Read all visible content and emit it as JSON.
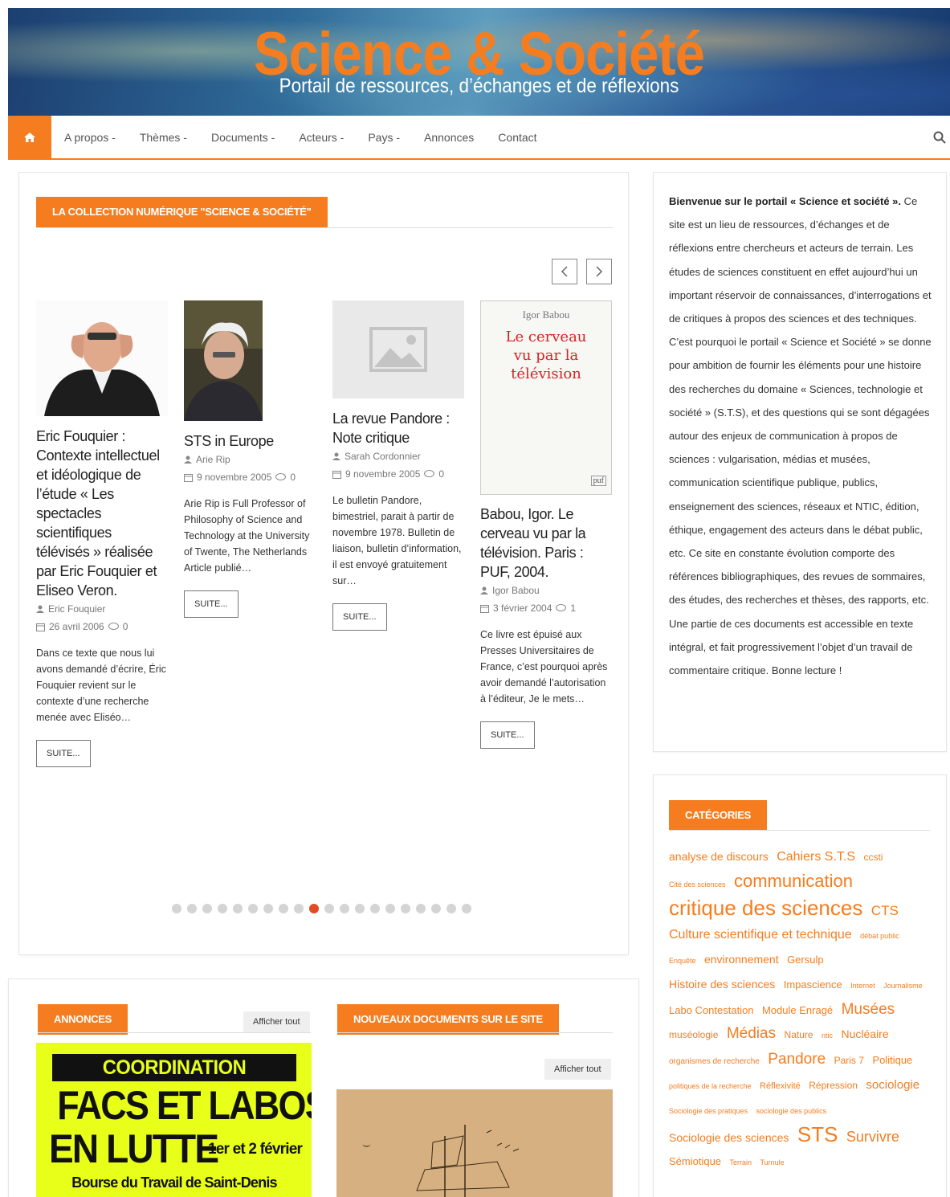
{
  "header": {
    "title": "Science & Société",
    "subtitle": "Portail de ressources, d’échanges et de réflexions"
  },
  "nav": {
    "home_icon": "home-icon",
    "items": [
      "A propos -",
      "Thèmes -",
      "Documents -",
      "Acteurs -",
      "Pays -",
      "Annonces",
      "Contact"
    ],
    "search_icon": "search-icon"
  },
  "collection": {
    "heading": "LA COLLECTION NUMÉRIQUE \"SCIENCE & SOCIÉTÉ\"",
    "prev_icon": "chevron-left-icon",
    "next_icon": "chevron-right-icon",
    "cards": [
      {
        "title": "Eric Fouquier : Contexte intellectuel et idéologique de l’étude « Les spectacles scientifiques télévisés » réalisée par Eric Fouquier et Eliseo Veron.",
        "author": "Eric Fouquier",
        "date": "26 avril 2006",
        "comments": "0",
        "excerpt": "Dans ce texte que nous lui avons demandé d’écrire, Éric Fouquier revient sur le contexte d’une recherche menée avec Eliséo…",
        "button": "SUITE..."
      },
      {
        "title": "STS in Europe",
        "author": "Arie Rip",
        "date": "9 novembre 2005",
        "comments": "0",
        "excerpt": "Arie Rip is Full Professor of Philosophy of Science and Technology at the University of Twente, The Netherlands Article publié…",
        "button": "SUITE..."
      },
      {
        "title": "La revue Pandore : Note critique",
        "author": "Sarah Cordonnier",
        "date": "9 novembre 2005",
        "comments": "0",
        "excerpt": "Le bulletin Pandore, bimestriel, parait à partir de novembre 1978. Bulletin de liaison, bulletin d’information, il est envoyé gratuitement sur…",
        "button": "SUITE..."
      },
      {
        "title": "Babou, Igor. Le cerveau vu par la télévision. Paris : PUF, 2004.",
        "author": "Igor Babou",
        "date": "3 février 2004",
        "comments": "1",
        "excerpt": "Ce livre est épuisé aux Presses Universitaires de France, c’est pourquoi après avoir demandé l’autorisation à l’éditeur, Je le mets…",
        "button": "SUITE..."
      }
    ],
    "book_cover": {
      "author": "Igor Babou",
      "title": "Le cerveau vu par la télévision",
      "publisher": "puf"
    },
    "dots_total": 20,
    "dots_active_index": 9
  },
  "intro": {
    "bold": "Bienvenue sur le portail « Science et société ».",
    "text": " Ce site est un lieu de ressources, d’échanges et de réflexions entre chercheurs et acteurs de terrain. Les études de sciences constituent en effet aujourd’hui un important réservoir de connaissances, d’interrogations et de critiques à propos des sciences et des techniques. C’est pourquoi le portail « Science et Société » se donne pour ambition de fournir les éléments pour une histoire des recherches du domaine « Sciences, technologie et société » (S.T.S), et des questions qui se sont dégagées autour des enjeux de communication à propos de sciences : vulgarisation, médias et musées, communication scientifique publique, publics, enseignement des sciences, réseaux et NTIC, édition, éthique, engagement des acteurs dans le débat public, etc. Ce site en constante évolution comporte des références bibliographiques, des revues de sommaires, des études, des recherches et thèses, des rapports, etc. Une partie de ces documents est accessible en texte intégral, et fait progressivement l’objet d’un travail de commentaire critique. Bonne lecture !"
  },
  "categories": {
    "heading": "CATÉGORIES",
    "tags": [
      {
        "label": "analyse de discours",
        "size": 14
      },
      {
        "label": "Cahiers S.T.S",
        "size": 16
      },
      {
        "label": "ccsti",
        "size": 12
      },
      {
        "label": "Cité des sciences",
        "size": 9
      },
      {
        "label": "communication",
        "size": 22
      },
      {
        "label": "critique des sciences",
        "size": 26
      },
      {
        "label": "CTS",
        "size": 17
      },
      {
        "label": "Culture scientifique et technique",
        "size": 16
      },
      {
        "label": "débat public",
        "size": 9
      },
      {
        "label": "Enquête",
        "size": 9
      },
      {
        "label": "environnement",
        "size": 14
      },
      {
        "label": "Gersulp",
        "size": 13
      },
      {
        "label": "Histoire des sciences",
        "size": 14
      },
      {
        "label": "Impascience",
        "size": 13
      },
      {
        "label": "Internet",
        "size": 9
      },
      {
        "label": "Journalisme",
        "size": 9
      },
      {
        "label": "Labo Contestation",
        "size": 13
      },
      {
        "label": "Module Enragé",
        "size": 13
      },
      {
        "label": "Musées",
        "size": 19
      },
      {
        "label": "muséologie",
        "size": 12
      },
      {
        "label": "Médias",
        "size": 19
      },
      {
        "label": "Nature",
        "size": 12
      },
      {
        "label": "ntic",
        "size": 9
      },
      {
        "label": "Nucléaire",
        "size": 14
      },
      {
        "label": "organismes de recherche",
        "size": 10
      },
      {
        "label": "Pandore",
        "size": 19
      },
      {
        "label": "Paris 7",
        "size": 12
      },
      {
        "label": "Politique",
        "size": 13
      },
      {
        "label": "politiques de la recherche",
        "size": 9
      },
      {
        "label": "Réflexivité",
        "size": 11
      },
      {
        "label": "Répression",
        "size": 12
      },
      {
        "label": "sociologie",
        "size": 15
      },
      {
        "label": "Sociologie des pratiques",
        "size": 9
      },
      {
        "label": "sociologie des publics",
        "size": 9
      },
      {
        "label": "Sociologie des sciences",
        "size": 14
      },
      {
        "label": "STS",
        "size": 26
      },
      {
        "label": "Survivre",
        "size": 18
      },
      {
        "label": "Sémiotique",
        "size": 13
      },
      {
        "label": "Terrain",
        "size": 9
      },
      {
        "label": "Turnule",
        "size": 9
      }
    ]
  },
  "annonces": {
    "heading": "ANNONCES",
    "button": "Afficher tout",
    "poster": {
      "line1": "COORDINATION NATIONALE",
      "line2": "FACS ET LABOS",
      "line3": "EN LUTTE",
      "dates": "1er et 2 février",
      "place": "Bourse du Travail de Saint-Denis"
    }
  },
  "nouveaux": {
    "heading": "NOUVEAUX DOCUMENTS SUR LE SITE",
    "button": "Afficher tout"
  },
  "colors": {
    "accent": "#f57d1f",
    "active_dot": "#e04b24",
    "poster_bg": "#e8ff1a"
  }
}
